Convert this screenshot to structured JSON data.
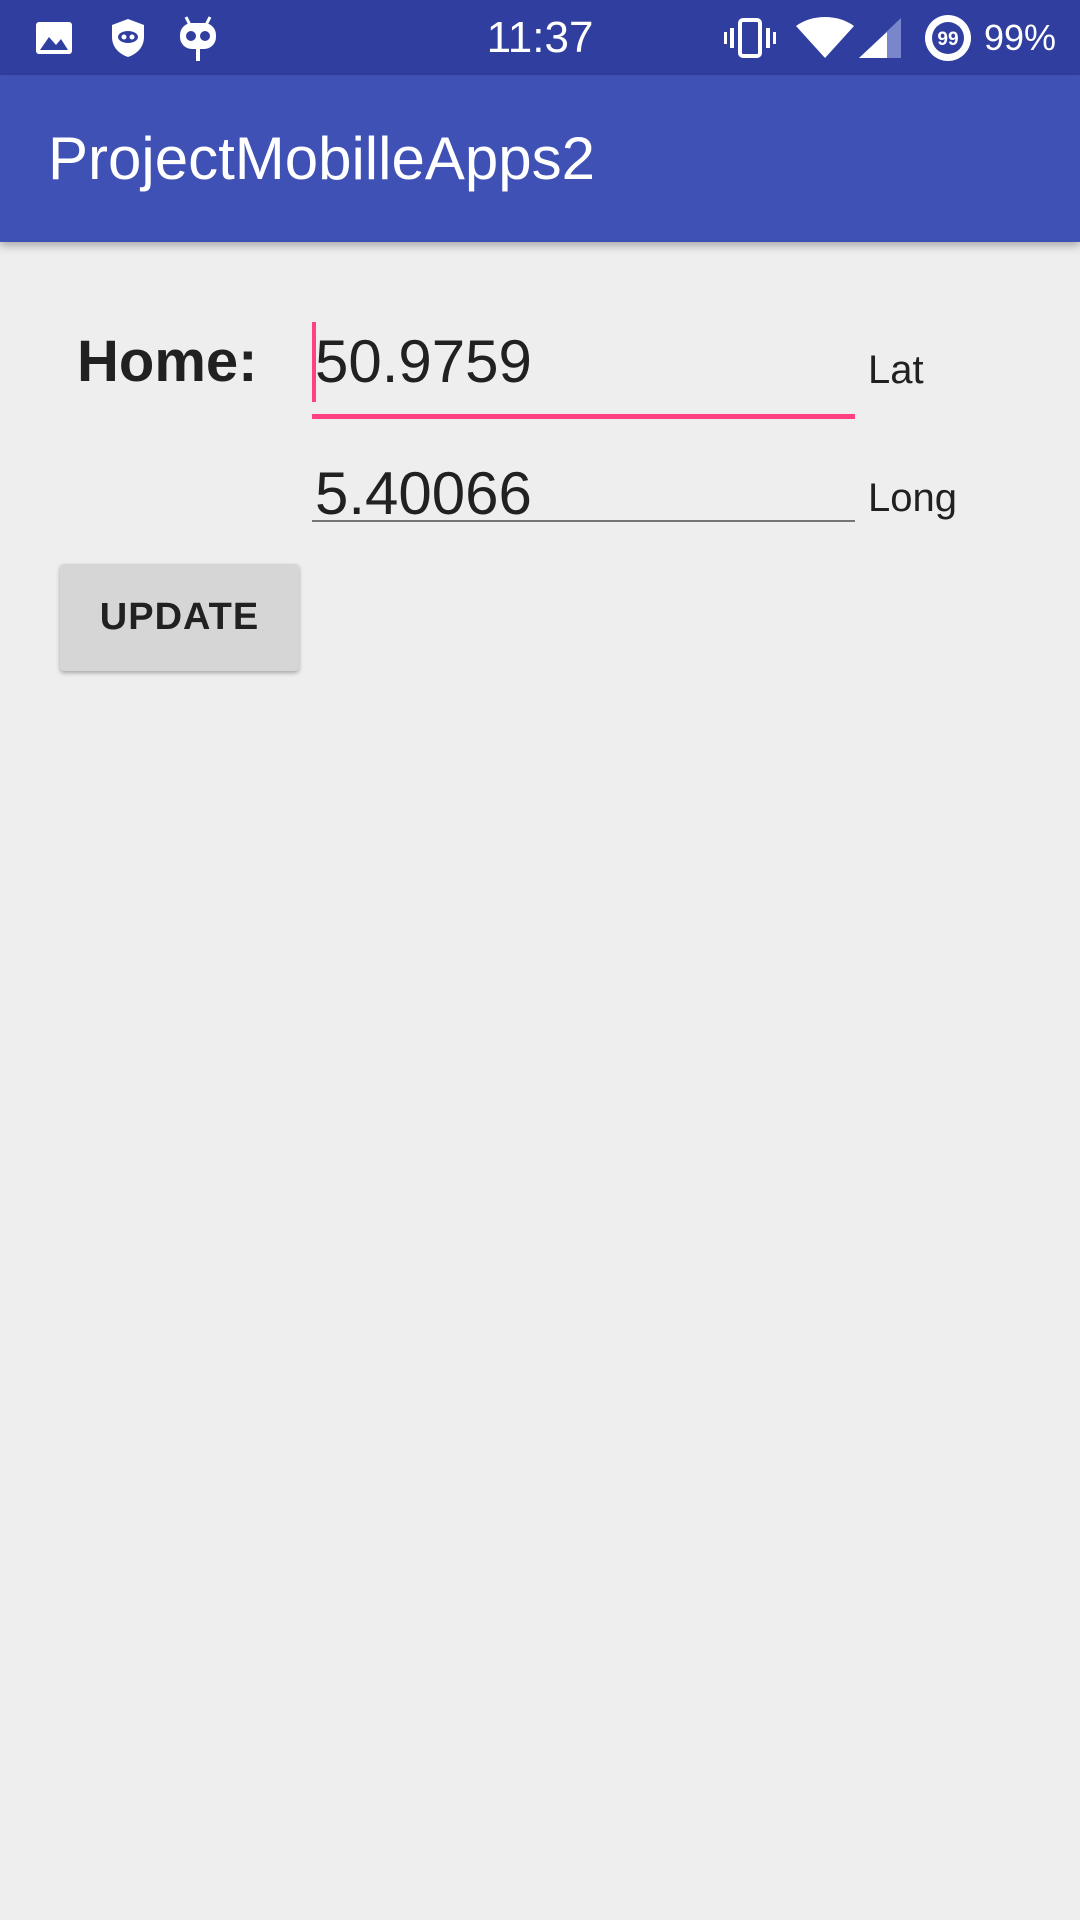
{
  "status_bar": {
    "time": "11:37",
    "battery_percent": "99%",
    "notification_badge": "99",
    "icons": [
      "image-icon",
      "shield-icon",
      "cyanogen-icon",
      "vibrate-icon",
      "wifi-icon",
      "signal-icon",
      "notification-count-icon"
    ]
  },
  "app_bar": {
    "title": "ProjectMobilleApps2"
  },
  "form": {
    "home_label": "Home:",
    "latitude_value": "50.9759",
    "latitude_unit": "Lat",
    "longitude_value": "5.40066",
    "longitude_unit": "Long",
    "update_label": "UPDATE"
  },
  "colors": {
    "status_bar": "#303F9F",
    "app_bar": "#3F51B5",
    "accent": "#FF4081",
    "background": "#EEEEEE"
  }
}
